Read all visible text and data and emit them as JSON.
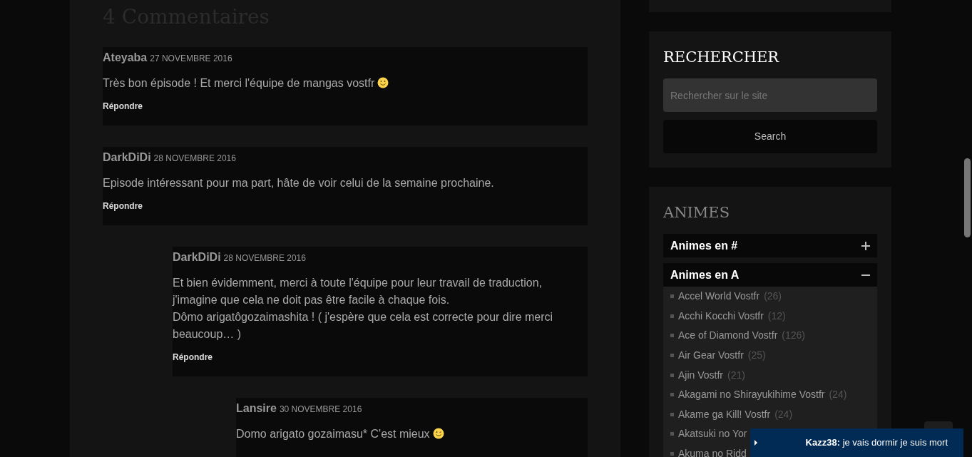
{
  "comments_section": {
    "heading": "4 Commentaires",
    "comments": [
      {
        "kind": "smiley",
        "author": "Ateyaba",
        "date": "27 NOVEMBRE 2016",
        "text": [
          "Très bon épisode ! Et merci l'équipe de mangas vostfr"
        ],
        "reply": "Répondre"
      },
      {
        "author": "DarkDiDi",
        "date": "28 NOVEMBRE 2016",
        "text": [
          "Episode intéressant pour ma part, hâte de voir celui de la semaine prochaine."
        ],
        "reply": "Répondre",
        "children": [
          {
            "author": "DarkDiDi",
            "date": "28 NOVEMBRE 2016",
            "text": [
              "Et bien évidemment, merci à toute l'équipe pour leur travail de traduction, j'imagine que cela ne doit pas être facile à chaque fois.",
              "Dômo arigatôgozaimashita ! ( j'espère que cela est correcte pour dire merci beaucoup… )"
            ],
            "reply": "Répondre",
            "children": [
              {
                "kind": "wink",
                "author": "Lansire",
                "date": "30 NOVEMBRE 2016",
                "text": [
                  "Domo arigato gozaimasu* C'est mieux"
                ]
              }
            ]
          }
        ]
      }
    ]
  },
  "sidebar": {
    "search": {
      "title": "RECHERCHER",
      "placeholder": "Rechercher sur le site",
      "button": "Search"
    },
    "animes": {
      "title": "ANIMES",
      "sections": [
        {
          "label": "Animes en #",
          "expanded": false
        },
        {
          "label": "Animes en A",
          "expanded": true,
          "items": [
            {
              "name": "Accel World Vostfr",
              "count": "(26)"
            },
            {
              "name": "Acchi Kocchi Vostfr",
              "count": "(12)"
            },
            {
              "name": "Ace of Diamond Vostfr",
              "count": "(126)"
            },
            {
              "name": "Air Gear Vostfr",
              "count": "(25)"
            },
            {
              "name": "Ajin Vostfr",
              "count": "(21)"
            },
            {
              "name": "Akagami no Shirayukihime Vostfr",
              "count": "(24)"
            },
            {
              "name": "Akame ga Kill! Vostfr",
              "count": "(24)"
            },
            {
              "name": "Akatsuki no Yor"
            },
            {
              "name": "Akuma no Ridd"
            }
          ]
        }
      ]
    }
  },
  "chat": {
    "message": "**Kazz38:** je vais dormir je suis mort"
  }
}
